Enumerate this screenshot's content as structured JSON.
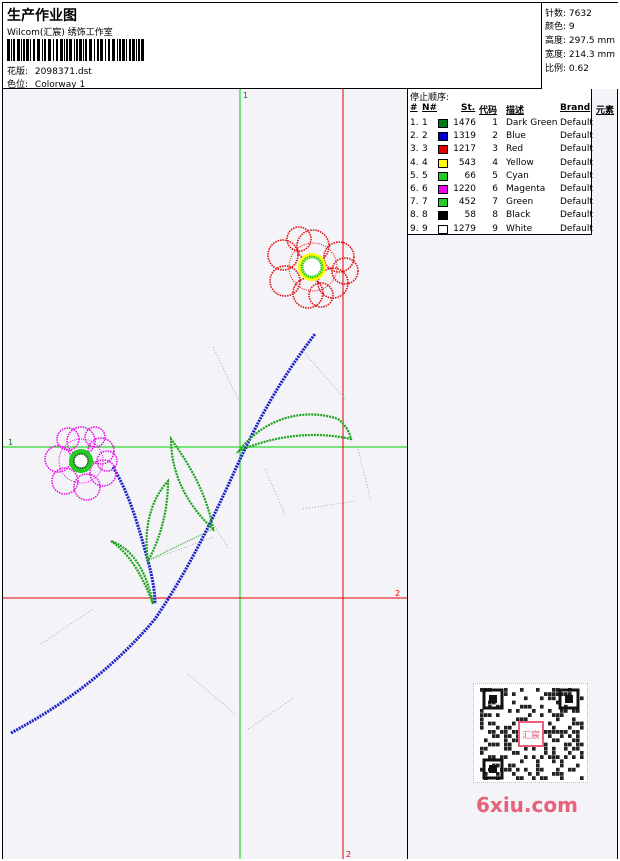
{
  "header": {
    "title": "生产作业图",
    "company": "Wilcom(汇宸) 绣饰工作室",
    "design_label": "花版:",
    "design_value": "2098371.dst",
    "colorway_label": "色位:",
    "colorway_value": "Colorway 1"
  },
  "stats": {
    "stitches": "针数: 7632",
    "colors": "颜色: 9",
    "height": "高度: 297.5 mm",
    "width": "宽度: 214.3 mm",
    "scale": "比例: 0.62"
  },
  "canvas": {
    "guide_green_top": "1",
    "guide_green_left": "1",
    "guide_red_right": "2",
    "guide_red_bottom": "2"
  },
  "stop_sequence": {
    "title": "停止顺序:",
    "headers": [
      "#",
      "N#",
      "St.",
      "代码",
      "描述",
      "Brand",
      "元素"
    ],
    "rows": [
      {
        "idx": "1.",
        "n": "1",
        "st": "1476",
        "code": "1",
        "desc": "Dark Green",
        "brand": "Default",
        "color": "#007a1a"
      },
      {
        "idx": "2.",
        "n": "2",
        "st": "1319",
        "code": "2",
        "desc": "Blue",
        "brand": "Default",
        "color": "#0000cc"
      },
      {
        "idx": "3.",
        "n": "3",
        "st": "1217",
        "code": "3",
        "desc": "Red",
        "brand": "Default",
        "color": "#e00000"
      },
      {
        "idx": "4.",
        "n": "4",
        "st": "543",
        "code": "4",
        "desc": "Yellow",
        "brand": "Default",
        "color": "#ffff00"
      },
      {
        "idx": "5.",
        "n": "5",
        "st": "66",
        "code": "5",
        "desc": "Cyan",
        "brand": "Default",
        "color": "#22cc22"
      },
      {
        "idx": "6.",
        "n": "6",
        "st": "1220",
        "code": "6",
        "desc": "Magenta",
        "brand": "Default",
        "color": "#ee00ee"
      },
      {
        "idx": "7.",
        "n": "7",
        "st": "452",
        "code": "7",
        "desc": "Green",
        "brand": "Default",
        "color": "#22cc22"
      },
      {
        "idx": "8.",
        "n": "8",
        "st": "58",
        "code": "8",
        "desc": "Black",
        "brand": "Default",
        "color": "#000000"
      },
      {
        "idx": "9.",
        "n": "9",
        "st": "1279",
        "code": "9",
        "desc": "White",
        "brand": "Default",
        "color": "#ffffff"
      }
    ]
  },
  "watermark": "6xiu.com",
  "qr_badge": "汇宸"
}
